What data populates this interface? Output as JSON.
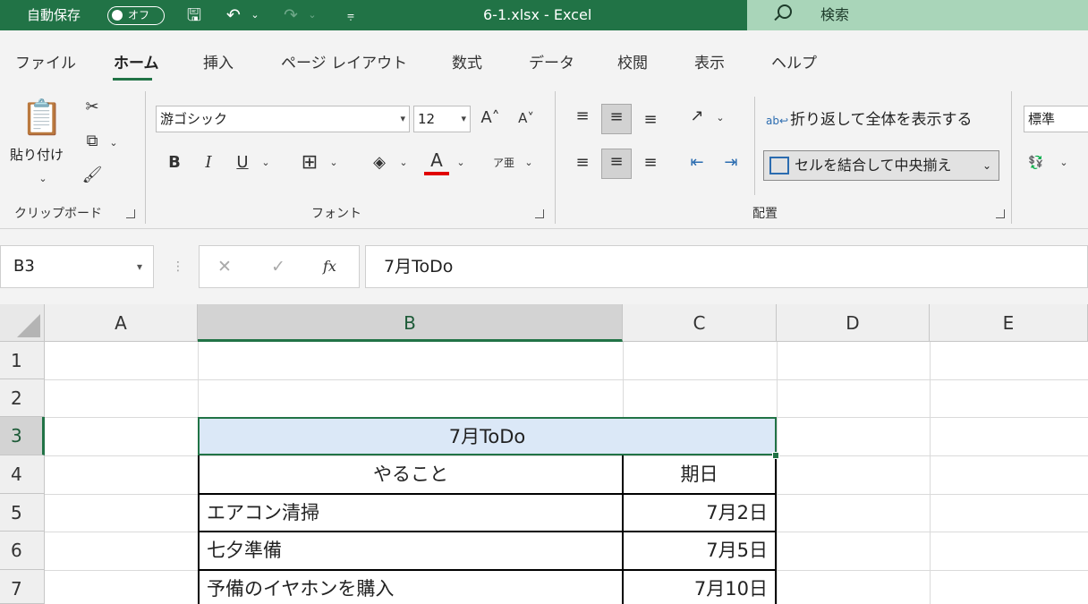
{
  "titlebar": {
    "autosave_label": "自動保存",
    "autosave_state": "オフ",
    "save_icon": "save-icon",
    "undo_icon": "undo-icon",
    "redo_icon": "redo-icon",
    "customize_icon": "customize-icon",
    "file_title": "6-1.xlsx  -  Excel",
    "search_placeholder": "検索"
  },
  "tabs": [
    "ファイル",
    "ホーム",
    "挿入",
    "ページ レイアウト",
    "数式",
    "データ",
    "校閲",
    "表示",
    "ヘルプ"
  ],
  "active_tab": "ホーム",
  "ribbon": {
    "clipboard": {
      "paste_label": "貼り付け",
      "group_label": "クリップボード"
    },
    "font": {
      "font_name": "游ゴシック",
      "font_size": "12",
      "group_label": "フォント"
    },
    "alignment": {
      "wrap_text_label": "折り返して全体を表示する",
      "merge_center_label": "セルを結合して中央揃え",
      "group_label": "配置"
    },
    "number": {
      "format": "標準"
    }
  },
  "formula_bar": {
    "name_box": "B3",
    "cancel_symbol": "✕",
    "enter_symbol": "✓",
    "fx_label": "fx",
    "content": "7月ToDo"
  },
  "grid": {
    "columns": [
      "A",
      "B",
      "C",
      "D",
      "E"
    ],
    "selected_column": "B",
    "rows": [
      "1",
      "2",
      "3",
      "4",
      "5",
      "6",
      "7"
    ],
    "selected_row": "3",
    "merged_title": "7月ToDo",
    "header": {
      "task": "やること",
      "date": "期日"
    },
    "items": [
      {
        "task": "エアコン清掃",
        "date": "7月2日"
      },
      {
        "task": "七夕準備",
        "date": "7月5日"
      },
      {
        "task": "予備のイヤホンを購入",
        "date": "7月10日"
      }
    ]
  },
  "colors": {
    "excel_green": "#217346",
    "selected_fill": "#dbe8f7"
  }
}
